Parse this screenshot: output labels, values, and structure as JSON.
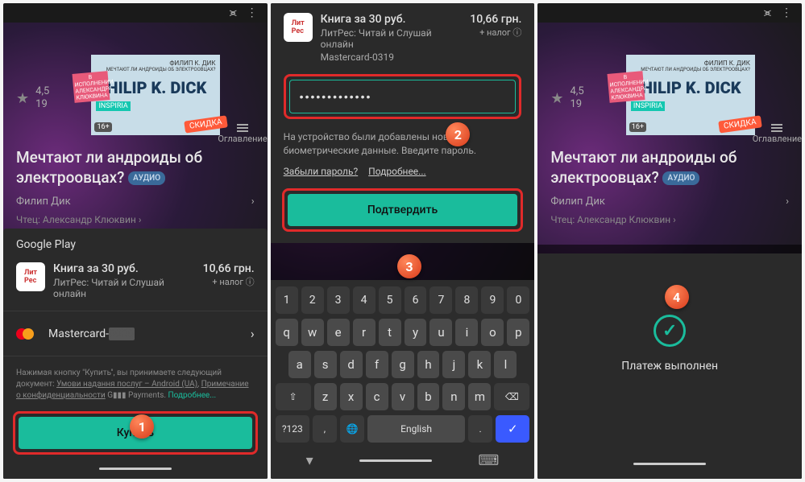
{
  "book": {
    "header_name": "ФИЛИП К. ДИК",
    "header_q": "МЕЧТАЮТ ЛИ АНДРОИДЫ ОБ ЭЛЕКТРООВЦАХ?",
    "title_main": "PHILIP K. DICK",
    "inspiria": "INSPIRIA",
    "skidka": "СКИДКА",
    "age": "16+",
    "perf": "В ИСПОЛНЕНИИ АЛЕКСАНДРА КЛЮКВИНА",
    "rating": "4,5",
    "rating_count": "19",
    "oglav": "Оглавление",
    "title": "Мечтают ли андроиды об электроовцах?",
    "audio": "АУДИО",
    "author": "Филип Дик",
    "narrator_label": "Чтец:",
    "narrator_name": "Александр Клюквин"
  },
  "purchase": {
    "gp": "Google Play",
    "name": "Книга за 30 руб.",
    "sub": "ЛитРес: Читай и Слушай онлайн",
    "price": "10,66 грн.",
    "tax": "+ налог ⓘ",
    "card": "Mastercard-",
    "card_full": "Mastercard-0319",
    "legal1": "Нажимая кнопку \"Купить\", вы принимаете следующий документ: ",
    "legal2": "Умови надання послуг – Android (UA)",
    "legal3": "Примечание о конфиденциальности",
    "legal4": "Payments",
    "legal_more": "Подробнее...",
    "buy": "Купить"
  },
  "confirm": {
    "pw_mask": "•••••••••••••",
    "bio": "На устройство были добавлены новые биометрические данные. Введите пароль.",
    "forgot": "Забыли пароль?",
    "more": "Подробнее...",
    "btn": "Подтвердить"
  },
  "kbd": {
    "nums": [
      "1",
      "2",
      "3",
      "4",
      "5",
      "6",
      "7",
      "8",
      "9",
      "0"
    ],
    "r2": [
      "q",
      "w",
      "e",
      "r",
      "t",
      "y",
      "u",
      "i",
      "o",
      "p"
    ],
    "r3": [
      "a",
      "s",
      "d",
      "f",
      "g",
      "h",
      "j",
      "k",
      "l"
    ],
    "r4": [
      "z",
      "x",
      "c",
      "v",
      "b",
      "n",
      "m"
    ],
    "shift": "⇧",
    "bksp": "⌫",
    "q123": "?123",
    "lang": "English",
    "comma": ",",
    "dot": ".",
    "globe": "🌐",
    "enter": "✓",
    "nav_down": "▾",
    "nav_kbd": "⌨"
  },
  "success": {
    "text": "Платеж выполнен"
  },
  "markers": {
    "m1": "1",
    "m2": "2",
    "m3": "3",
    "m4": "4"
  }
}
